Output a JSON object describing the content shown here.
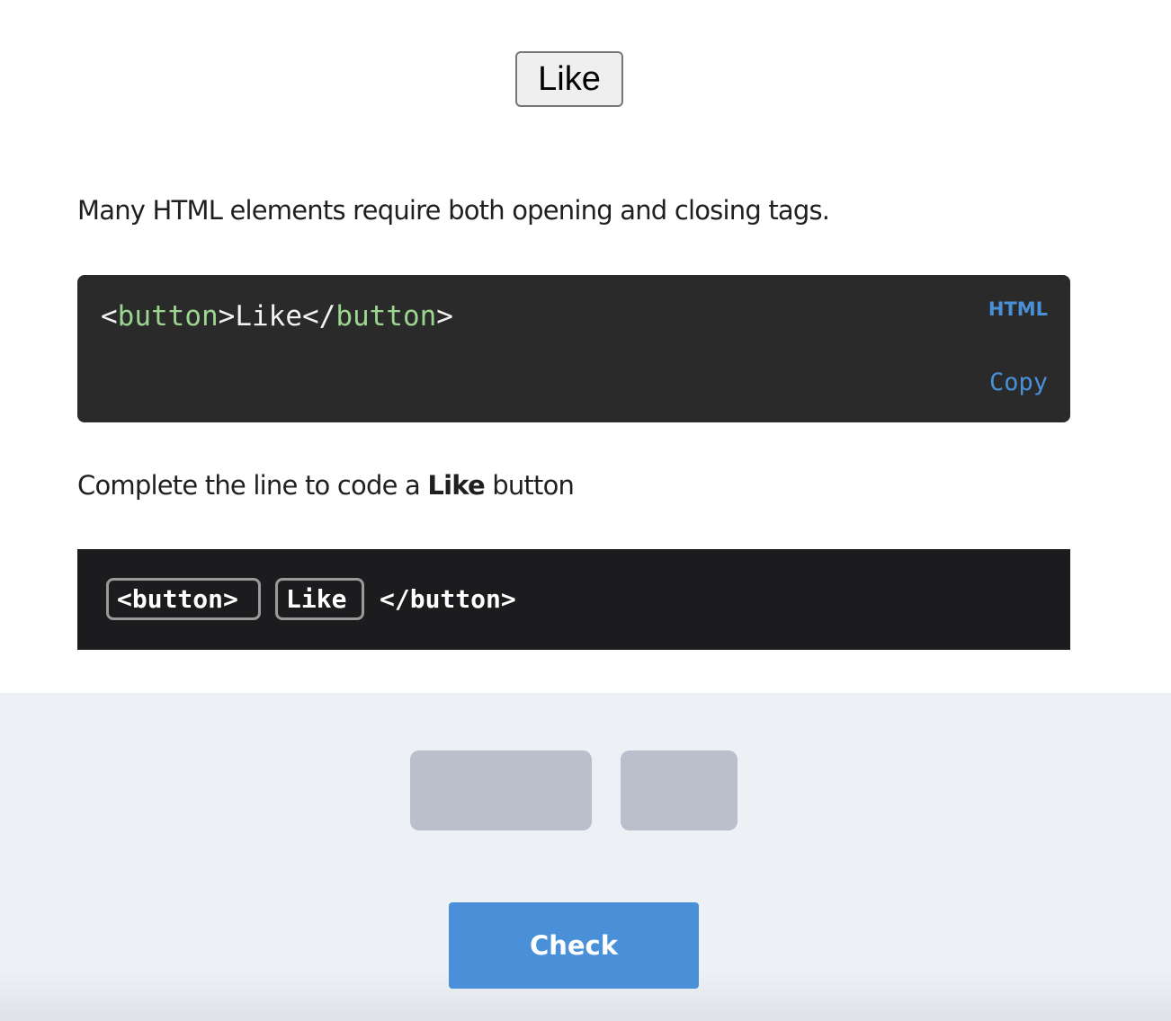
{
  "preview": {
    "button_label": "Like"
  },
  "lesson": {
    "intro": "Many HTML elements require both opening and closing tags."
  },
  "code_example": {
    "open_bracket": "<",
    "open_tag_name": "button",
    "open_close_bracket": ">",
    "content": "Like",
    "close_open_bracket": "</",
    "close_tag_name": "button",
    "close_close_bracket": ">",
    "language": "HTML",
    "copy_label": "Copy"
  },
  "task": {
    "prefix": "Complete the line to code a ",
    "bold_word": "Like",
    "suffix": " button"
  },
  "answer": {
    "tokens": [
      "<button>",
      "Like"
    ],
    "static_suffix": "</button>"
  },
  "actions": {
    "check_label": "Check"
  },
  "colors": {
    "accent": "#4a90d9",
    "code_bg": "#2a2a2a",
    "answer_bg": "#1c1c1e",
    "bank_bg": "#edf0f5",
    "slot": "#b9c0cb",
    "tag_name": "#9bd58f"
  }
}
